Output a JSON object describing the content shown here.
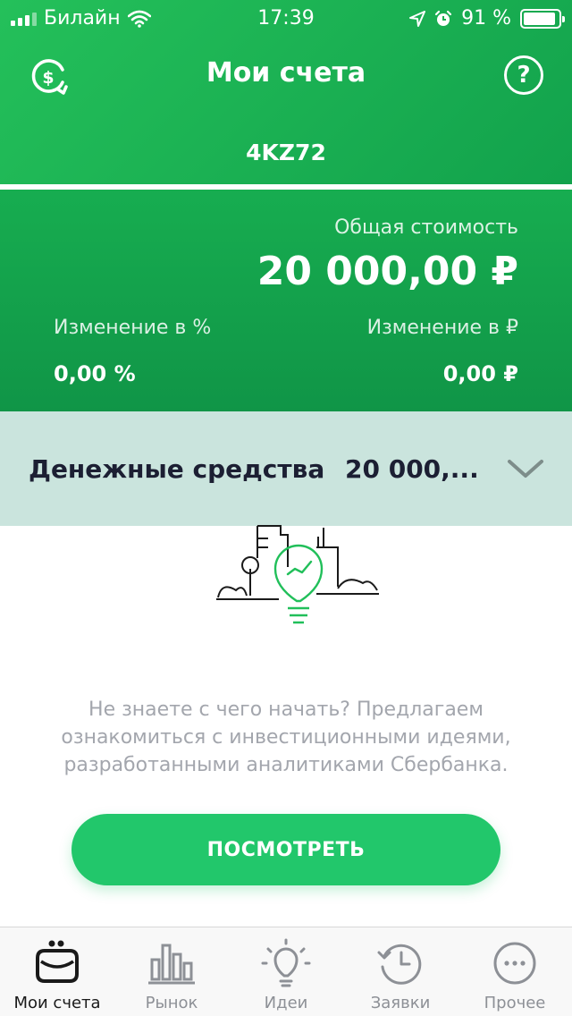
{
  "status_bar": {
    "carrier": "Билайн",
    "time": "17:39",
    "battery": "91 %",
    "battery_level": 0.91
  },
  "header": {
    "title": "Мои счета",
    "account": "4KZ72",
    "help_symbol": "?",
    "left_icon": "dollar-refresh-icon",
    "right_icon": "help-icon"
  },
  "summary": {
    "total_label": "Общая стоимость",
    "total_value": "20 000,00 ₽",
    "change_percent_label": "Изменение в %",
    "change_percent_value": "0,00 %",
    "change_rub_label": "Изменение в ₽",
    "change_rub_value": "0,00 ₽"
  },
  "cash": {
    "label": "Денежные средства",
    "value": "20 000,..."
  },
  "promo": {
    "text": "Не знаете с чего начать? Предлагаем\nознакомиться с инвестиционными идеями,\nразработанными аналитиками Сбербанка.",
    "button_label": "ПОСМОТРЕТЬ"
  },
  "tabs": [
    {
      "label": "Мои счета",
      "icon": "wallet-icon",
      "active": true
    },
    {
      "label": "Рынок",
      "icon": "market-chart-icon",
      "active": false
    },
    {
      "label": "Идеи",
      "icon": "lightbulb-icon",
      "active": false
    },
    {
      "label": "Заявки",
      "icon": "history-clock-icon",
      "active": false
    },
    {
      "label": "Прочее",
      "icon": "more-dots-icon",
      "active": false
    }
  ],
  "colors": {
    "brand_green": "#21bf5a",
    "cash_row_bg": "#cae4dd",
    "button_green": "#22c76b"
  }
}
